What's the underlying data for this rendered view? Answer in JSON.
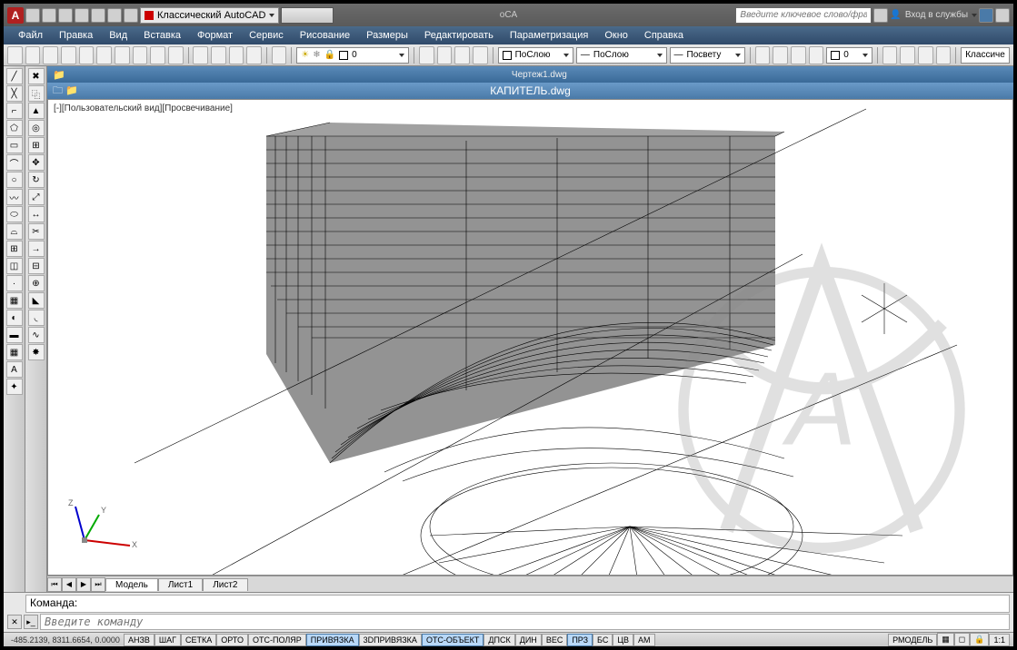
{
  "app": {
    "logo": "A",
    "workspace": "Классический AutoCAD",
    "winTitle": "oCA"
  },
  "search": {
    "placeholder": "Введите ключевое слово/фразу"
  },
  "login": {
    "label": "Вход в службы"
  },
  "menu": [
    "Файл",
    "Правка",
    "Вид",
    "Вставка",
    "Формат",
    "Сервис",
    "Рисование",
    "Размеры",
    "Редактировать",
    "Параметризация",
    "Окно",
    "Справка"
  ],
  "props": {
    "layerCombo": "ПоСлою",
    "ltCombo": "ПоСлою",
    "lwCombo": "Посвету",
    "zero": "0",
    "style": "Классиче"
  },
  "doc": {
    "file1": "Чертеж1.dwg",
    "file2": "КАПИТЕЛЬ.dwg",
    "viewLabel": "[-][Пользовательский вид][Просвечивание]"
  },
  "ucs": {
    "x": "X",
    "y": "Y",
    "z": "Z"
  },
  "sheets": {
    "model": "Модель",
    "s1": "Лист1",
    "s2": "Лист2"
  },
  "cmd": {
    "prompt": "Команда:",
    "placeholder": "Введите команду"
  },
  "status": {
    "coords": "-485.2139, 8311.6654, 0.0000",
    "btns": [
      "АНЗВ",
      "ШАГ",
      "СЕТКА",
      "ОРТО",
      "ОТС-ПОЛЯР",
      "ПРИВЯЗКА",
      "3DПРИВЯЗКА",
      "ОТС-ОБЪЕКТ",
      "ДПСК",
      "ДИН",
      "ВЕС",
      "ПРЗ",
      "БС",
      "ЦВ",
      "АМ"
    ],
    "on": [
      5,
      7,
      11
    ],
    "right": "РМОДЕЛЬ",
    "scale": "1:1"
  }
}
